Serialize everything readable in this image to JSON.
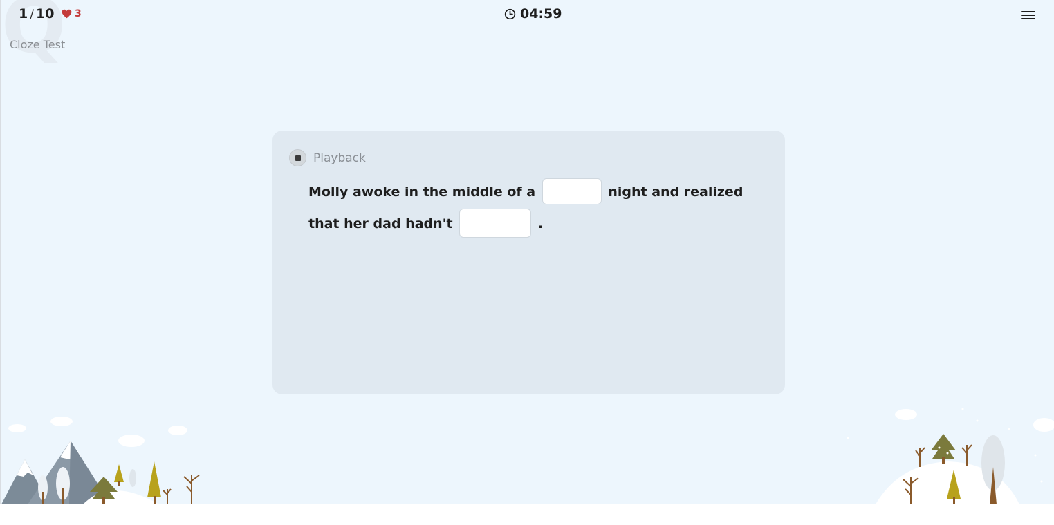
{
  "header": {
    "progress_current": "1",
    "progress_separator": "/",
    "progress_total": "10",
    "lives": "3",
    "timer": "04:59",
    "test_title": "Cloze Test"
  },
  "card": {
    "playback_label": "Playback",
    "sentence": {
      "part1": "Molly awoke in the middle of a",
      "part2": "night and realized that her dad hadn't",
      "part3": "."
    }
  },
  "colors": {
    "background": "#edf6fd",
    "card": "#e0e9f1",
    "heart": "#c43a3a",
    "text": "#1e1e1e",
    "muted": "#8a8f95"
  },
  "icons": [
    "heart-icon",
    "clock-icon",
    "menu-icon",
    "stop-icon"
  ]
}
